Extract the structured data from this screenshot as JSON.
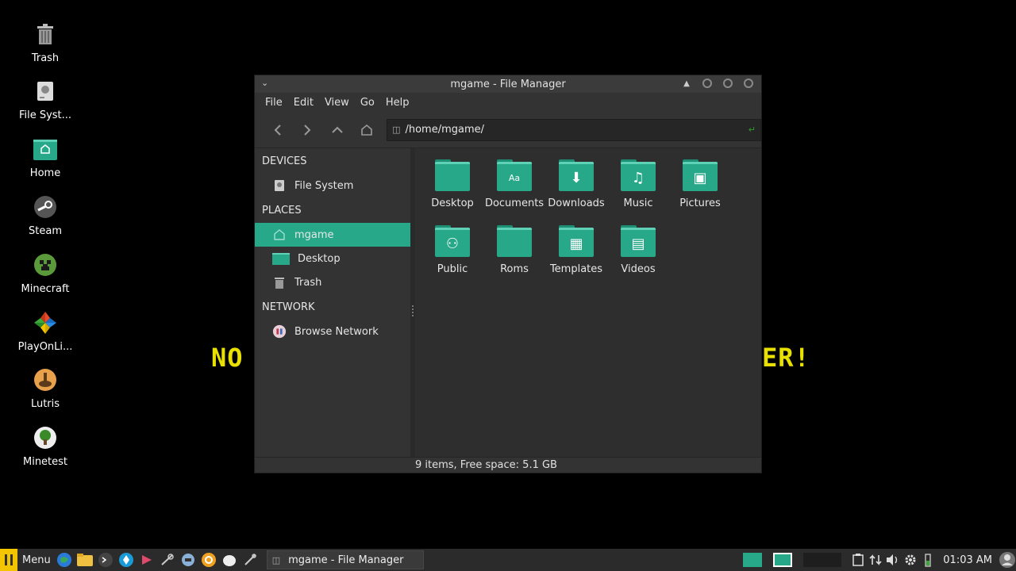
{
  "desktop": {
    "icons": [
      {
        "name": "Trash",
        "icon": "trash-icon"
      },
      {
        "name": "File Syst...",
        "icon": "harddrive-icon"
      },
      {
        "name": "Home",
        "icon": "home-folder-icon"
      },
      {
        "name": "Steam",
        "icon": "steam-icon"
      },
      {
        "name": "Minecraft",
        "icon": "minecraft-icon"
      },
      {
        "name": "PlayOnLi...",
        "icon": "playonlinux-icon"
      },
      {
        "name": "Lutris",
        "icon": "lutris-icon"
      },
      {
        "name": "Minetest",
        "icon": "minetest-icon"
      }
    ],
    "banner_left": "NO",
    "banner_right": "ER!"
  },
  "window": {
    "title": "mgame - File Manager",
    "menu": [
      "File",
      "Edit",
      "View",
      "Go",
      "Help"
    ],
    "path": "/home/mgame/",
    "sidebar": {
      "devices_header": "DEVICES",
      "devices": [
        {
          "label": "File System",
          "icon": "harddrive-icon"
        }
      ],
      "places_header": "PLACES",
      "places": [
        {
          "label": "mgame",
          "icon": "home-icon",
          "active": true
        },
        {
          "label": "Desktop",
          "icon": "desktop-folder-icon"
        },
        {
          "label": "Trash",
          "icon": "trash-icon"
        }
      ],
      "network_header": "NETWORK",
      "network": [
        {
          "label": "Browse Network",
          "icon": "network-icon"
        }
      ]
    },
    "folders": [
      {
        "label": "Desktop",
        "glyph": ""
      },
      {
        "label": "Documents",
        "glyph": "Aa"
      },
      {
        "label": "Downloads",
        "glyph": "⬇"
      },
      {
        "label": "Music",
        "glyph": "♫"
      },
      {
        "label": "Pictures",
        "glyph": "▣"
      },
      {
        "label": "Public",
        "glyph": "⚇"
      },
      {
        "label": "Roms",
        "glyph": ""
      },
      {
        "label": "Templates",
        "glyph": "▦"
      },
      {
        "label": "Videos",
        "glyph": "▤"
      }
    ],
    "status": "9 items, Free space: 5.1 GB"
  },
  "taskbar": {
    "menu_label": "Menu",
    "task_title": "mgame - File Manager",
    "clock": "01:03 AM"
  },
  "colors": {
    "accent": "#26a889",
    "banner": "#e8e000",
    "menu_logo": "#f2c500"
  }
}
